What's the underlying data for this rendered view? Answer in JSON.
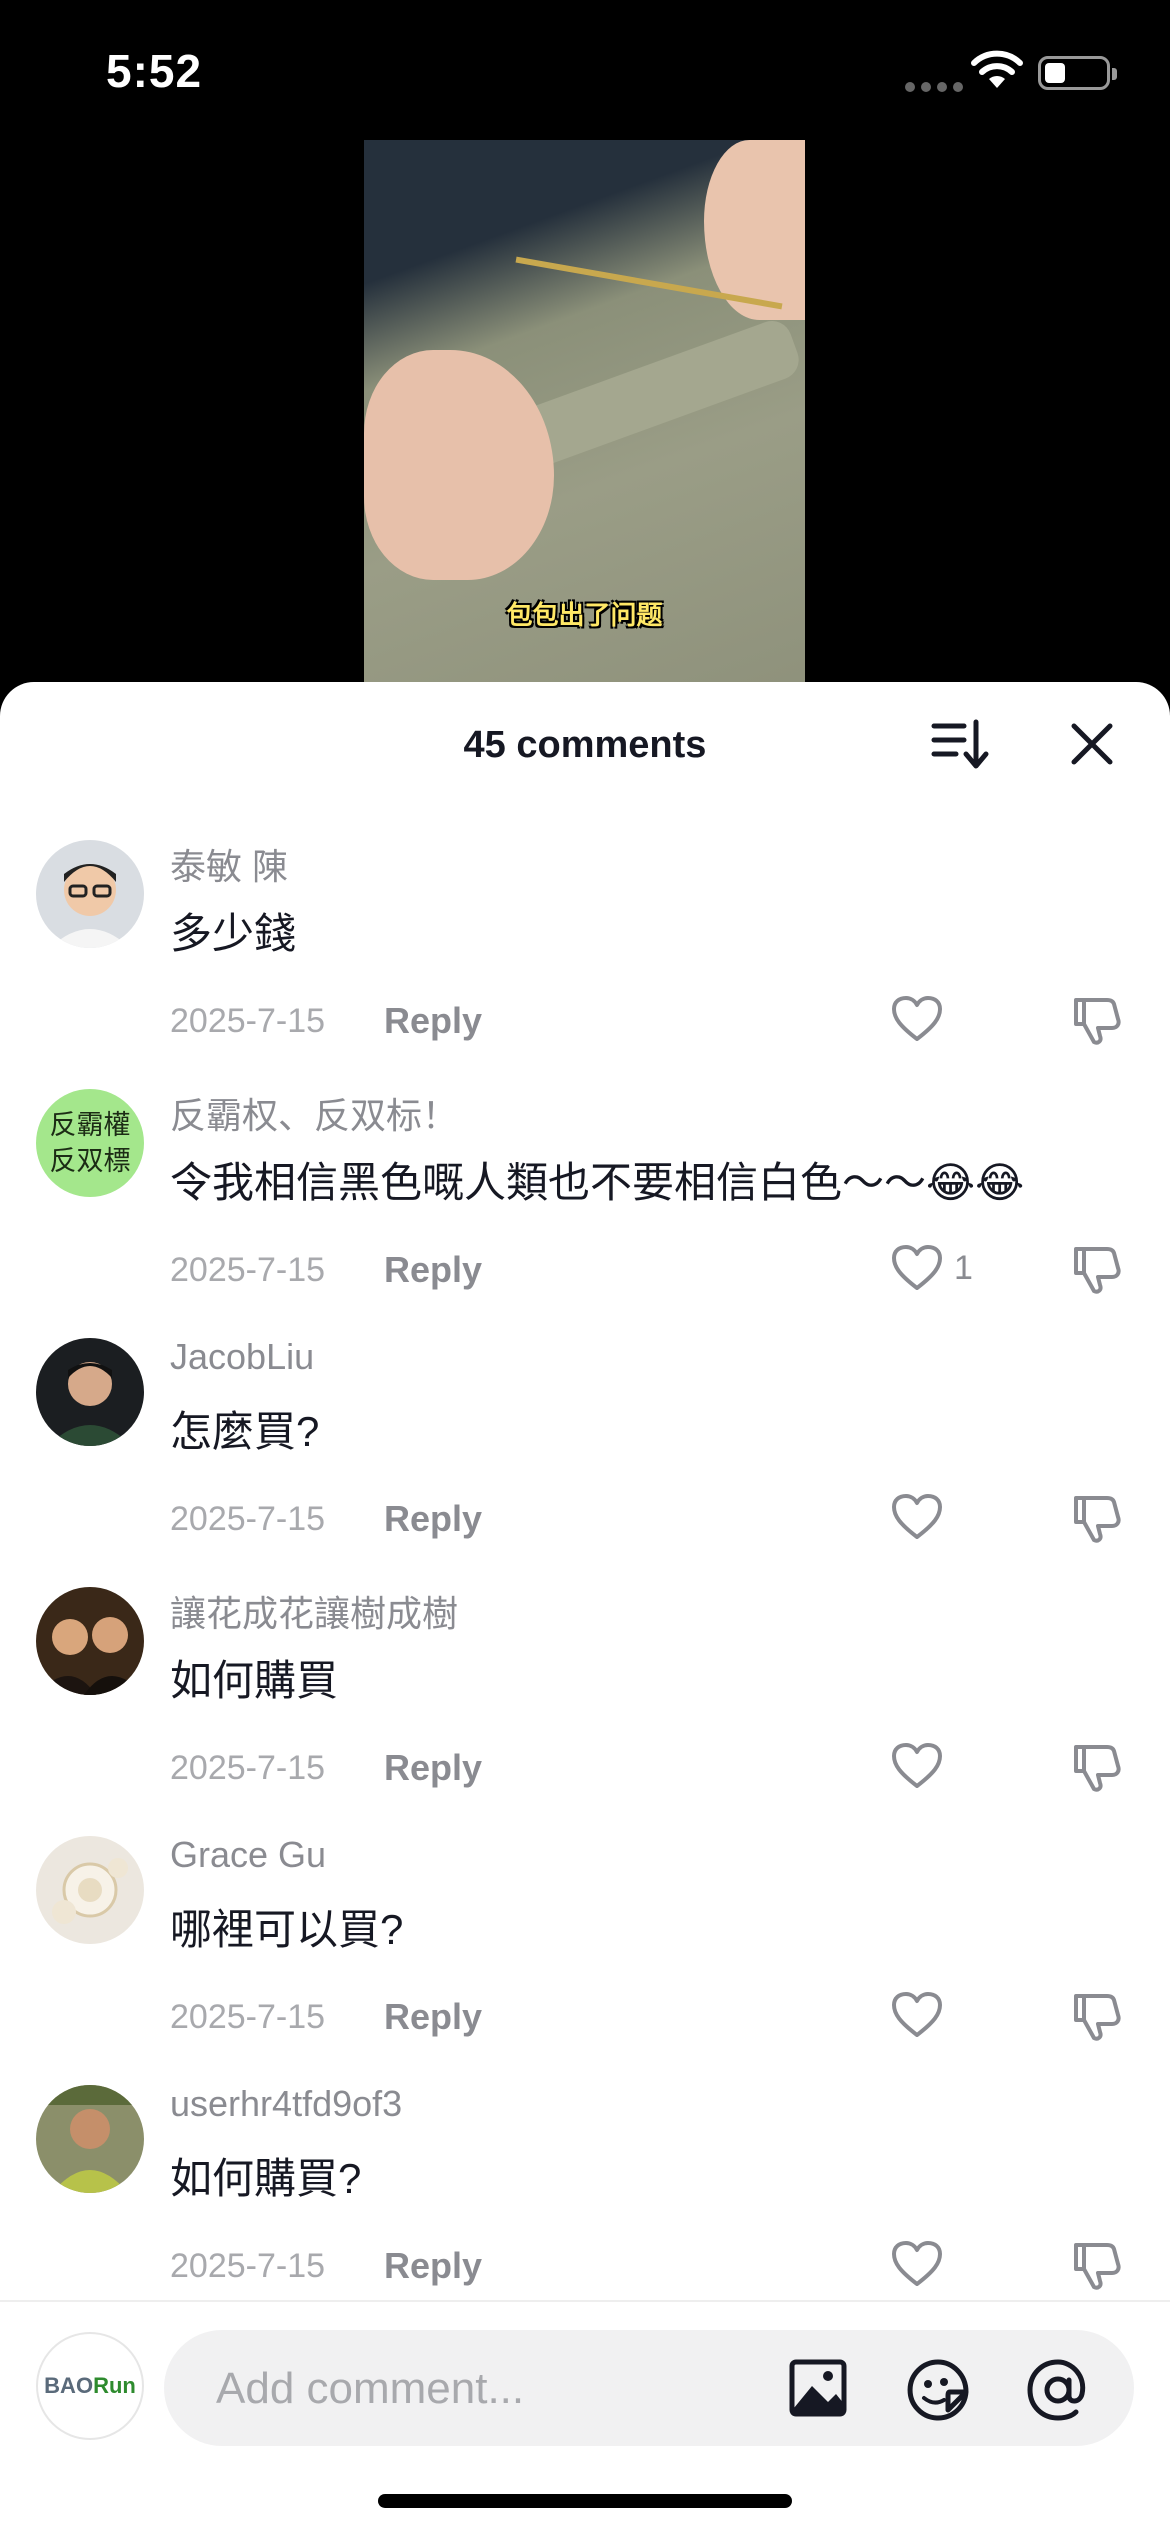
{
  "status_bar": {
    "time": "5:52"
  },
  "video": {
    "caption": "包包出了问题"
  },
  "sheet": {
    "comment_count": "45 comments",
    "sort_icon": "sort-icon",
    "close_icon": "close-icon"
  },
  "comments": [
    {
      "username": "泰敏 陳",
      "text": "多少錢",
      "date": "2025-7-15",
      "reply_label": "Reply",
      "likes": ""
    },
    {
      "username": "反霸权、反双标！",
      "text": "令我相信黑色嘅人類也不要相信白色～～😂😂",
      "date": "2025-7-15",
      "reply_label": "Reply",
      "likes": "1",
      "avatar_text": [
        "反霸權",
        "反双標"
      ]
    },
    {
      "username": "JacobLiu",
      "text": "怎麼買?",
      "date": "2025-7-15",
      "reply_label": "Reply",
      "likes": ""
    },
    {
      "username": "讓花成花讓樹成樹",
      "text": "如何購買",
      "date": "2025-7-15",
      "reply_label": "Reply",
      "likes": ""
    },
    {
      "username": "Grace Gu",
      "text": "哪裡可以買?",
      "date": "2025-7-15",
      "reply_label": "Reply",
      "likes": ""
    },
    {
      "username": "userhr4tfd9of3",
      "text": "如何購買?",
      "date": "2025-7-15",
      "reply_label": "Reply",
      "likes": ""
    }
  ],
  "composer": {
    "placeholder": "Add comment...",
    "my_avatar_text": [
      "BAO",
      "Run"
    ]
  },
  "colors": {
    "text": "#161823",
    "muted": "#8a8b91",
    "date": "#a8a9ad",
    "input_bg": "#f1f1f2"
  }
}
